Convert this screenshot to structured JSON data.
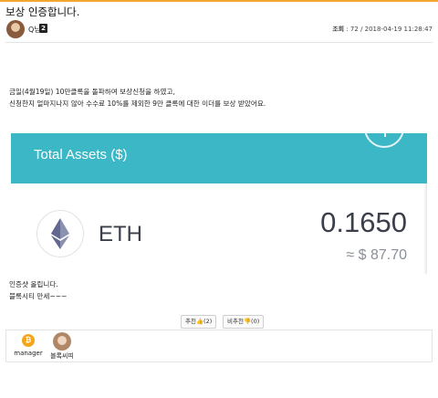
{
  "post": {
    "title": "보상 인증합니다.",
    "author": "Q님",
    "level": "2",
    "meta_prefix": "조회",
    "meta_rest": " : 72 / 2018-04-19 11:28:47"
  },
  "content": {
    "line1": "금일(4월19일) 10만클록을 돌파하여 보상신청을 하였고,",
    "line2": "신청한지 얼마지나지 않아 수수료 10%를 제외한 9만 클록에 대한 이더를 보상 받았어요.",
    "footer1": "인증샷 올립니다.",
    "footer2": "블록시티 만세~~~"
  },
  "asset_card": {
    "title": "Total Assets ($)",
    "coin": "ETH",
    "amount": "0.1650",
    "usd": "≈ $ 87.70",
    "accent": "#3cb7c6"
  },
  "votes": {
    "up": "추천👍(2)",
    "down": "비추천👎(0)"
  },
  "users": [
    {
      "name": "manager",
      "icon": "bitcoin-icon",
      "glyph": "₿"
    },
    {
      "name": "블록씨띠",
      "icon": "avatar"
    }
  ]
}
